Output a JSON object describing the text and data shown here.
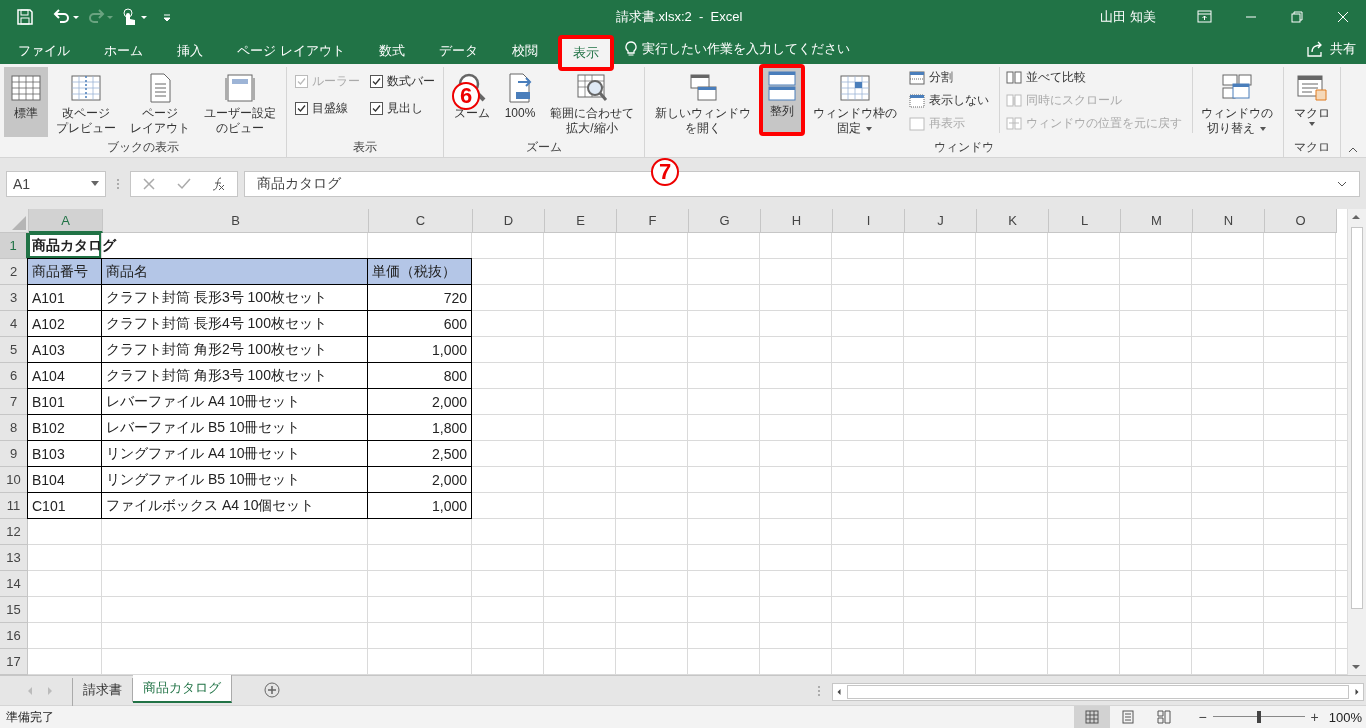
{
  "window": {
    "title": "請求書.xlsx:2  -  Excel",
    "user": "山田 知美"
  },
  "tabs": [
    {
      "label": "ファイル",
      "selected": false,
      "marked": false
    },
    {
      "label": "ホーム",
      "selected": false,
      "marked": false
    },
    {
      "label": "挿入",
      "selected": false,
      "marked": false
    },
    {
      "label": "ページ レイアウト",
      "selected": false,
      "marked": false
    },
    {
      "label": "数式",
      "selected": false,
      "marked": false
    },
    {
      "label": "データ",
      "selected": false,
      "marked": false
    },
    {
      "label": "校閲",
      "selected": false,
      "marked": false
    },
    {
      "label": "表示",
      "selected": true,
      "marked": true
    }
  ],
  "tell_me": {
    "placeholder": "実行したい作業を入力してください"
  },
  "share": "共有",
  "ribbon": {
    "groups": [
      {
        "name": "ブックの表示",
        "items": [
          {
            "kind": "large",
            "lines": [
              "標準"
            ],
            "highlighted": true,
            "dropdown": false,
            "marked": false
          },
          {
            "kind": "large",
            "lines": [
              "改ページ",
              "プレビュー"
            ],
            "highlighted": false,
            "dropdown": false,
            "marked": false
          },
          {
            "kind": "large",
            "lines": [
              "ページ",
              "レイアウト"
            ],
            "highlighted": false,
            "dropdown": false,
            "marked": false
          },
          {
            "kind": "large",
            "lines": [
              "ユーザー設定",
              "のビュー"
            ],
            "highlighted": false,
            "dropdown": false,
            "marked": false
          }
        ]
      },
      {
        "name": "表示",
        "items": [
          {
            "kind": "checks",
            "items": [
              {
                "label": "ルーラー",
                "checked": true,
                "disabled": true
              },
              {
                "label": "数式バー",
                "checked": true,
                "disabled": false
              },
              {
                "label": "目盛線",
                "checked": true,
                "disabled": false
              },
              {
                "label": "見出し",
                "checked": true,
                "disabled": false
              }
            ]
          }
        ]
      },
      {
        "name": "ズーム",
        "items": [
          {
            "kind": "large",
            "lines": [
              "ズーム"
            ],
            "highlighted": false,
            "dropdown": false,
            "marked": false
          },
          {
            "kind": "large",
            "lines": [
              "100%"
            ],
            "highlighted": false,
            "dropdown": false,
            "marked": false
          },
          {
            "kind": "large",
            "lines": [
              "範囲に合わせて",
              "拡大/縮小"
            ],
            "highlighted": false,
            "dropdown": false,
            "marked": false
          }
        ]
      },
      {
        "name": "ウィンドウ",
        "items": [
          {
            "kind": "large",
            "lines": [
              "新しいウィンドウ",
              "を開く"
            ],
            "highlighted": false,
            "dropdown": false,
            "marked": false
          },
          {
            "kind": "large",
            "lines": [
              "整列"
            ],
            "highlighted": true,
            "dropdown": false,
            "marked": true
          },
          {
            "kind": "large",
            "lines": [
              "ウィンドウ枠の",
              "固定"
            ],
            "highlighted": false,
            "dropdown": true,
            "marked": false
          },
          {
            "kind": "stack",
            "items": [
              {
                "label": "分割",
                "disabled": false
              },
              {
                "label": "表示しない",
                "disabled": false
              },
              {
                "label": "再表示",
                "disabled": true
              }
            ]
          },
          {
            "kind": "stack",
            "items": [
              {
                "label": "並べて比較",
                "disabled": false
              },
              {
                "label": "同時にスクロール",
                "disabled": true
              },
              {
                "label": "ウィンドウの位置を元に戻す",
                "disabled": true
              }
            ]
          },
          {
            "kind": "large",
            "lines": [
              "ウィンドウの",
              "切り替え"
            ],
            "highlighted": false,
            "dropdown": true,
            "marked": false
          }
        ]
      },
      {
        "name": "マクロ",
        "items": [
          {
            "kind": "large",
            "lines": [
              "マクロ"
            ],
            "highlighted": false,
            "dropdown": true,
            "marked": false
          }
        ]
      }
    ]
  },
  "steps": [
    {
      "label": "6"
    },
    {
      "label": "7"
    }
  ],
  "formula_bar": {
    "name_box": "A1",
    "formula": "商品カタログ"
  },
  "grid": {
    "columns": [
      {
        "label": "A",
        "selected": true
      },
      {
        "label": "B",
        "selected": false
      },
      {
        "label": "C",
        "selected": false
      },
      {
        "label": "D",
        "selected": false
      },
      {
        "label": "E",
        "selected": false
      },
      {
        "label": "F",
        "selected": false
      },
      {
        "label": "G",
        "selected": false
      },
      {
        "label": "H",
        "selected": false
      },
      {
        "label": "I",
        "selected": false
      },
      {
        "label": "J",
        "selected": false
      },
      {
        "label": "K",
        "selected": false
      },
      {
        "label": "L",
        "selected": false
      },
      {
        "label": "M",
        "selected": false
      },
      {
        "label": "N",
        "selected": false
      },
      {
        "label": "O",
        "selected": false
      }
    ],
    "rows": [
      {
        "label": "1",
        "selected": true,
        "kind": "title",
        "cells": [
          "商品カタログ"
        ]
      },
      {
        "label": "2",
        "selected": false,
        "kind": "header",
        "cells": [
          "商品番号",
          "商品名",
          "単価（税抜）"
        ]
      },
      {
        "label": "3",
        "selected": false,
        "kind": "data",
        "cells": [
          "A101",
          "クラフト封筒 長形3号 100枚セット",
          "720"
        ]
      },
      {
        "label": "4",
        "selected": false,
        "kind": "data",
        "cells": [
          "A102",
          "クラフト封筒 長形4号 100枚セット",
          "600"
        ]
      },
      {
        "label": "5",
        "selected": false,
        "kind": "data",
        "cells": [
          "A103",
          "クラフト封筒 角形2号 100枚セット",
          "1,000"
        ]
      },
      {
        "label": "6",
        "selected": false,
        "kind": "data",
        "cells": [
          "A104",
          "クラフト封筒 角形3号 100枚セット",
          "800"
        ]
      },
      {
        "label": "7",
        "selected": false,
        "kind": "data",
        "cells": [
          "B101",
          "レバーファイル A4 10冊セット",
          "2,000"
        ]
      },
      {
        "label": "8",
        "selected": false,
        "kind": "data",
        "cells": [
          "B102",
          "レバーファイル B5 10冊セット",
          "1,800"
        ]
      },
      {
        "label": "9",
        "selected": false,
        "kind": "data",
        "cells": [
          "B103",
          "リングファイル A4 10冊セット",
          "2,500"
        ]
      },
      {
        "label": "10",
        "selected": false,
        "kind": "data",
        "cells": [
          "B104",
          "リングファイル B5 10冊セット",
          "2,000"
        ]
      },
      {
        "label": "11",
        "selected": false,
        "kind": "data",
        "cells": [
          "C101",
          "ファイルボックス A4 10個セット",
          "1,000"
        ]
      },
      {
        "label": "12",
        "selected": false,
        "kind": "empty"
      },
      {
        "label": "13",
        "selected": false,
        "kind": "empty"
      },
      {
        "label": "14",
        "selected": false,
        "kind": "empty"
      },
      {
        "label": "15",
        "selected": false,
        "kind": "empty"
      },
      {
        "label": "16",
        "selected": false,
        "kind": "empty"
      },
      {
        "label": "17",
        "selected": false,
        "kind": "empty"
      }
    ]
  },
  "sheets": [
    {
      "label": "請求書",
      "selected": false
    },
    {
      "label": "商品カタログ",
      "selected": true
    }
  ],
  "status_bar": {
    "text": "準備完了",
    "views": [
      {
        "selected": true
      },
      {
        "selected": false
      },
      {
        "selected": false
      }
    ],
    "zoom": {
      "zoom_out": "−",
      "zoom_in": "+",
      "level": 0.5,
      "reading": "100%"
    }
  }
}
